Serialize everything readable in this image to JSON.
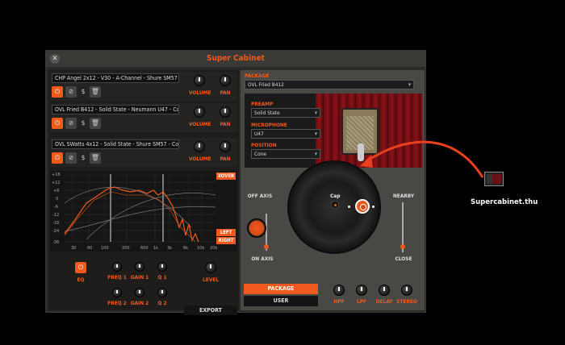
{
  "window": {
    "title": "Super Cabinet"
  },
  "slots": [
    {
      "name": "CHP Angel 2x12 - V30 - A-Channel - Shure SM57 - Cone -..."
    },
    {
      "name": "OVL Fried B412 - Solid State - Neumann U47 - Cone - Clos..."
    },
    {
      "name": "OVL SWatts 4x12 - Solid State - Shure SM57 - Cone - Clos..."
    }
  ],
  "slot_controls": {
    "volume": "VOLUME",
    "pan": "PAN",
    "dollar": "$"
  },
  "graph": {
    "y_ticks": [
      "+18",
      "+12",
      "+6",
      "0",
      "-6",
      "-12",
      "-18",
      "-24",
      "-36"
    ],
    "x_ticks": [
      "30",
      "60",
      "100",
      "200",
      "600",
      "1k",
      "3k",
      "6k",
      "10k",
      "20k"
    ],
    "xover_label": "XOVER",
    "left_label": "LEFT",
    "right_label": "RIGHT"
  },
  "eq": {
    "eq_label": "EQ",
    "freq1": "FREQ 1",
    "gain1": "GAIN 1",
    "q1": "Q 1",
    "freq2": "FREQ 2",
    "gain2": "GAIN 2",
    "q2": "Q 2",
    "level": "LEVEL",
    "export": "EXPORT"
  },
  "package": {
    "label": "PACKAGE",
    "selected": "OVL Fried B412",
    "preamp_label": "PREAMP",
    "preamp_value": "Solid State",
    "microphone_label": "MICROPHONE",
    "microphone_value": "U47",
    "position_label": "POSITION",
    "position_value": "Cone"
  },
  "mic_position": {
    "off_axis": "OFF AXIS",
    "on_axis": "ON AXIS",
    "nearby": "NEARBY",
    "close": "CLOSE",
    "cap": "Cap"
  },
  "bottom": {
    "package_btn": "PACKAGE",
    "user_btn": "USER",
    "hpf": "HPF",
    "lpf": "LPF",
    "delay": "DELAY",
    "stereo": "STEREO"
  },
  "file": {
    "label": "Supercabinet.thu"
  },
  "colors": {
    "accent": "#f05a1e",
    "panel": "#2b2a28"
  }
}
